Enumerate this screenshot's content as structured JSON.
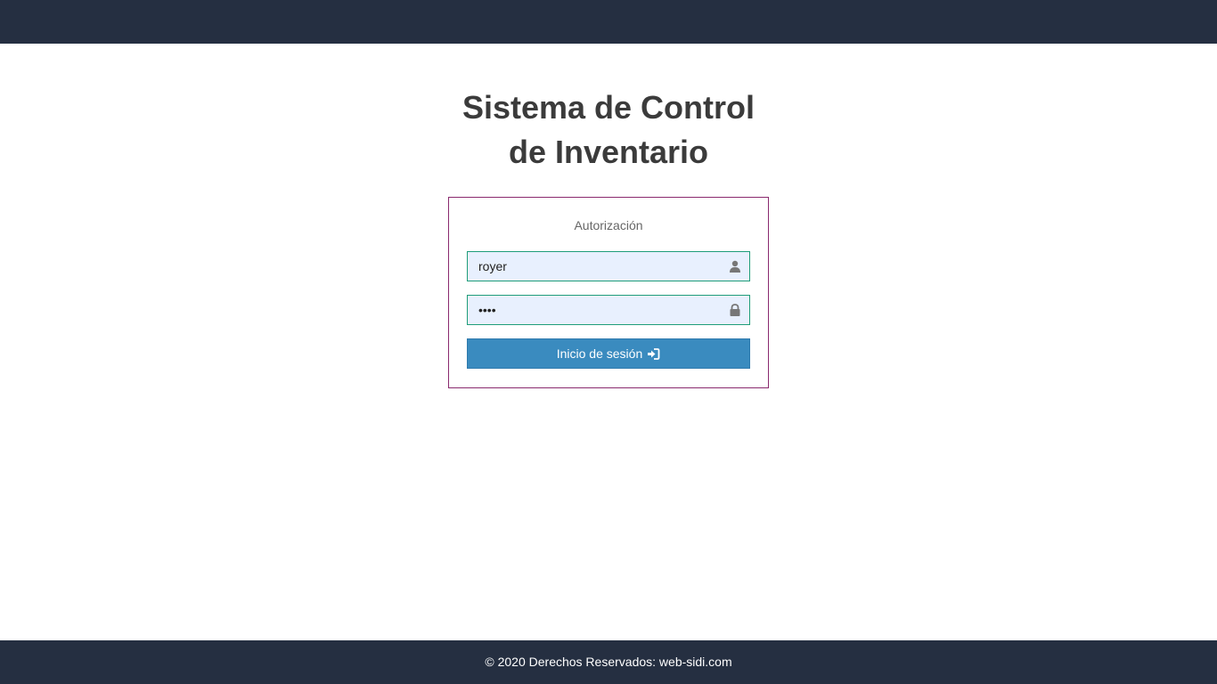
{
  "header": {},
  "title": {
    "line1": "Sistema de Control",
    "line2": "de Inventario"
  },
  "login": {
    "heading": "Autorización",
    "username": {
      "value": "royer",
      "icon": "user-icon"
    },
    "password": {
      "value": "••••",
      "icon": "lock-icon"
    },
    "submit": {
      "label": "Inicio de sesión",
      "icon": "sign-in-icon"
    }
  },
  "footer": {
    "text": "© 2020 Derechos Reservados: web-sidi.com"
  },
  "colors": {
    "bar": "#252f41",
    "card_border": "#8a2a6e",
    "field_border": "#1f9d7a",
    "field_bg": "#e8f0fe",
    "button": "#3a8bbf"
  }
}
